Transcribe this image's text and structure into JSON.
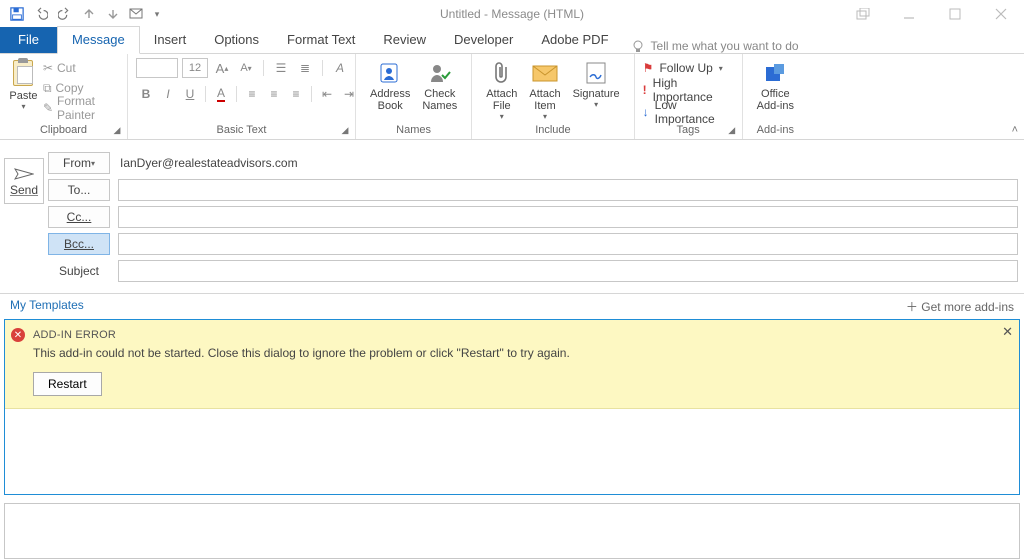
{
  "window": {
    "title": "Untitled - Message (HTML)"
  },
  "tabs": {
    "file": "File",
    "message": "Message",
    "insert": "Insert",
    "options": "Options",
    "format_text": "Format Text",
    "review": "Review",
    "developer": "Developer",
    "adobe_pdf": "Adobe PDF",
    "tell_me": "Tell me what you want to do"
  },
  "ribbon": {
    "clipboard": {
      "label": "Clipboard",
      "paste": "Paste",
      "cut": "Cut",
      "copy": "Copy",
      "format_painter": "Format Painter"
    },
    "basic_text": {
      "label": "Basic Text",
      "font_size": "12"
    },
    "names": {
      "label": "Names",
      "address_book": "Address\nBook",
      "check_names": "Check\nNames"
    },
    "include": {
      "label": "Include",
      "attach_file": "Attach\nFile",
      "attach_item": "Attach\nItem",
      "signature": "Signature"
    },
    "tags": {
      "label": "Tags",
      "follow_up": "Follow Up",
      "high": "High Importance",
      "low": "Low Importance"
    },
    "addins": {
      "label": "Add-ins",
      "office_addins": "Office\nAdd-ins"
    }
  },
  "compose": {
    "send": "Send",
    "from_label": "From",
    "from_value": "IanDyer@realestateadvisors.com",
    "to": "To...",
    "cc": "Cc...",
    "bcc": "Bcc...",
    "subject": "Subject"
  },
  "templates": {
    "my_templates": "My Templates",
    "get_more": "Get more add-ins"
  },
  "error": {
    "title": "ADD-IN ERROR",
    "message": "This add-in could not be started. Close this dialog to ignore the problem or click \"Restart\" to try again.",
    "restart": "Restart"
  }
}
